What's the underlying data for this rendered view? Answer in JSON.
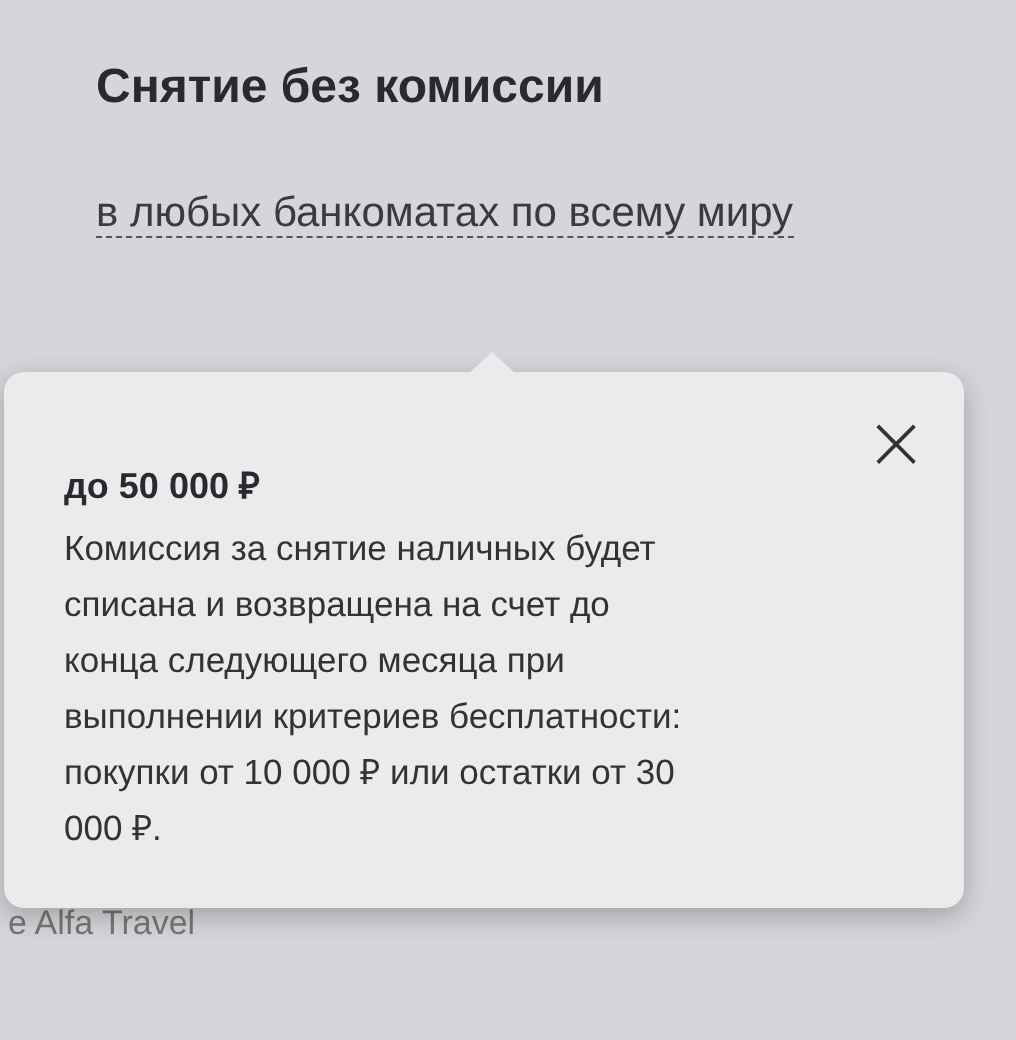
{
  "title": "Снятие без комиссии",
  "link": "в любых банкоматах по всему миру",
  "tooltip": {
    "amount": "до 50 000 ₽",
    "text": "Комиссия за снятие наличных будет списана и возвращена на счет до конца следующего месяца при выполнении критериев бесплатности: покупки от 10 000 ₽ или остатки от 30 000 ₽.",
    "close": "×"
  },
  "footer_text": "e Alfa Travel"
}
